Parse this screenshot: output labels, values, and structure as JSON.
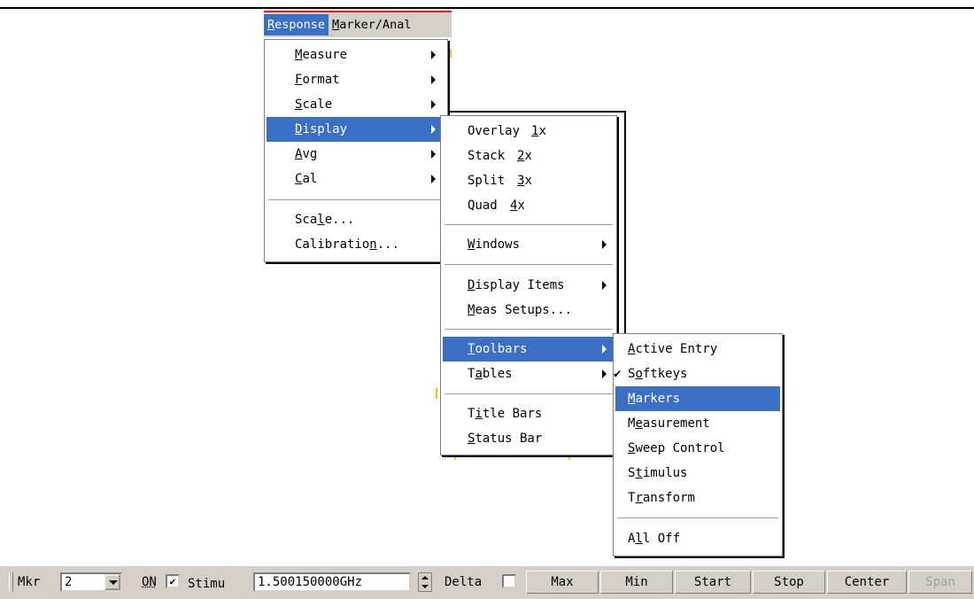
{
  "menubar": {
    "items": [
      {
        "pre": "",
        "u": "R",
        "post": "esponse"
      },
      {
        "pre": "",
        "u": "M",
        "post": "arker/Anal"
      }
    ]
  },
  "response_menu": {
    "items": [
      {
        "pre": "",
        "u": "M",
        "post": "easure",
        "submenu": true
      },
      {
        "pre": "",
        "u": "F",
        "post": "ormat",
        "submenu": true
      },
      {
        "pre": "",
        "u": "S",
        "post": "cale",
        "submenu": true
      },
      {
        "pre": "",
        "u": "D",
        "post": "isplay",
        "submenu": true,
        "highlighted": true
      },
      {
        "pre": "",
        "u": "A",
        "post": "vg",
        "submenu": true
      },
      {
        "pre": "",
        "u": "C",
        "post": "al",
        "submenu": true
      },
      {
        "pre": "Sca",
        "u": "l",
        "post": "e..."
      },
      {
        "pre": "Calibratio",
        "u": "n",
        "post": "..."
      }
    ]
  },
  "display_menu": {
    "items": [
      {
        "text": "Overlay",
        "key_u": "1",
        "key_post": "x"
      },
      {
        "text": "Stack",
        "key_u": "2",
        "key_post": "x"
      },
      {
        "text": "Split",
        "key_u": "3",
        "key_post": "x"
      },
      {
        "text": "Quad",
        "key_u": "4",
        "key_post": "x"
      },
      {
        "pre": "",
        "u": "W",
        "post": "indows",
        "submenu": true
      },
      {
        "pre": "",
        "u": "D",
        "post": "isplay Items",
        "submenu": true
      },
      {
        "pre": "",
        "u": "M",
        "post": "eas Setups..."
      },
      {
        "pre": "",
        "u": "T",
        "post": "oolbars",
        "submenu": true,
        "highlighted": true
      },
      {
        "pre": "T",
        "u": "a",
        "post": "bles",
        "submenu": true
      },
      {
        "pre": "T",
        "u": "i",
        "post": "tle Bars"
      },
      {
        "pre": "",
        "u": "S",
        "post": "tatus Bar"
      }
    ]
  },
  "toolbars_menu": {
    "items": [
      {
        "pre": "",
        "u": "A",
        "post": "ctive Entry"
      },
      {
        "pre": "S",
        "u": "o",
        "post": "ftkeys",
        "checked": true,
        "check": "✔"
      },
      {
        "pre": "",
        "u": "M",
        "post": "arkers",
        "highlighted": true
      },
      {
        "pre": "M",
        "u": "e",
        "post": "asurement"
      },
      {
        "pre": "",
        "u": "S",
        "post": "weep Control"
      },
      {
        "pre": "S",
        "u": "t",
        "post": "imulus"
      },
      {
        "pre": "T",
        "u": "r",
        "post": "ansform"
      },
      {
        "pre": "A",
        "u": "l",
        "post": "l Off"
      }
    ]
  },
  "toolbar": {
    "mkr_label": "Mkr",
    "mkr_value": "2",
    "on_label": "ON",
    "on_checked": "✔",
    "stimu_label": "Stimu",
    "stimu_value": "1.500150000GHz",
    "delta_label": "Delta",
    "buttons": [
      "Max",
      "Min",
      "Start",
      "Stop",
      "Center",
      "Span"
    ]
  },
  "colors": {
    "highlight": "#3a6fc4",
    "toolbar_bg": "#d4d0c8",
    "menubar_border": "#e02020",
    "disabled_text": "#a0a0a0"
  }
}
